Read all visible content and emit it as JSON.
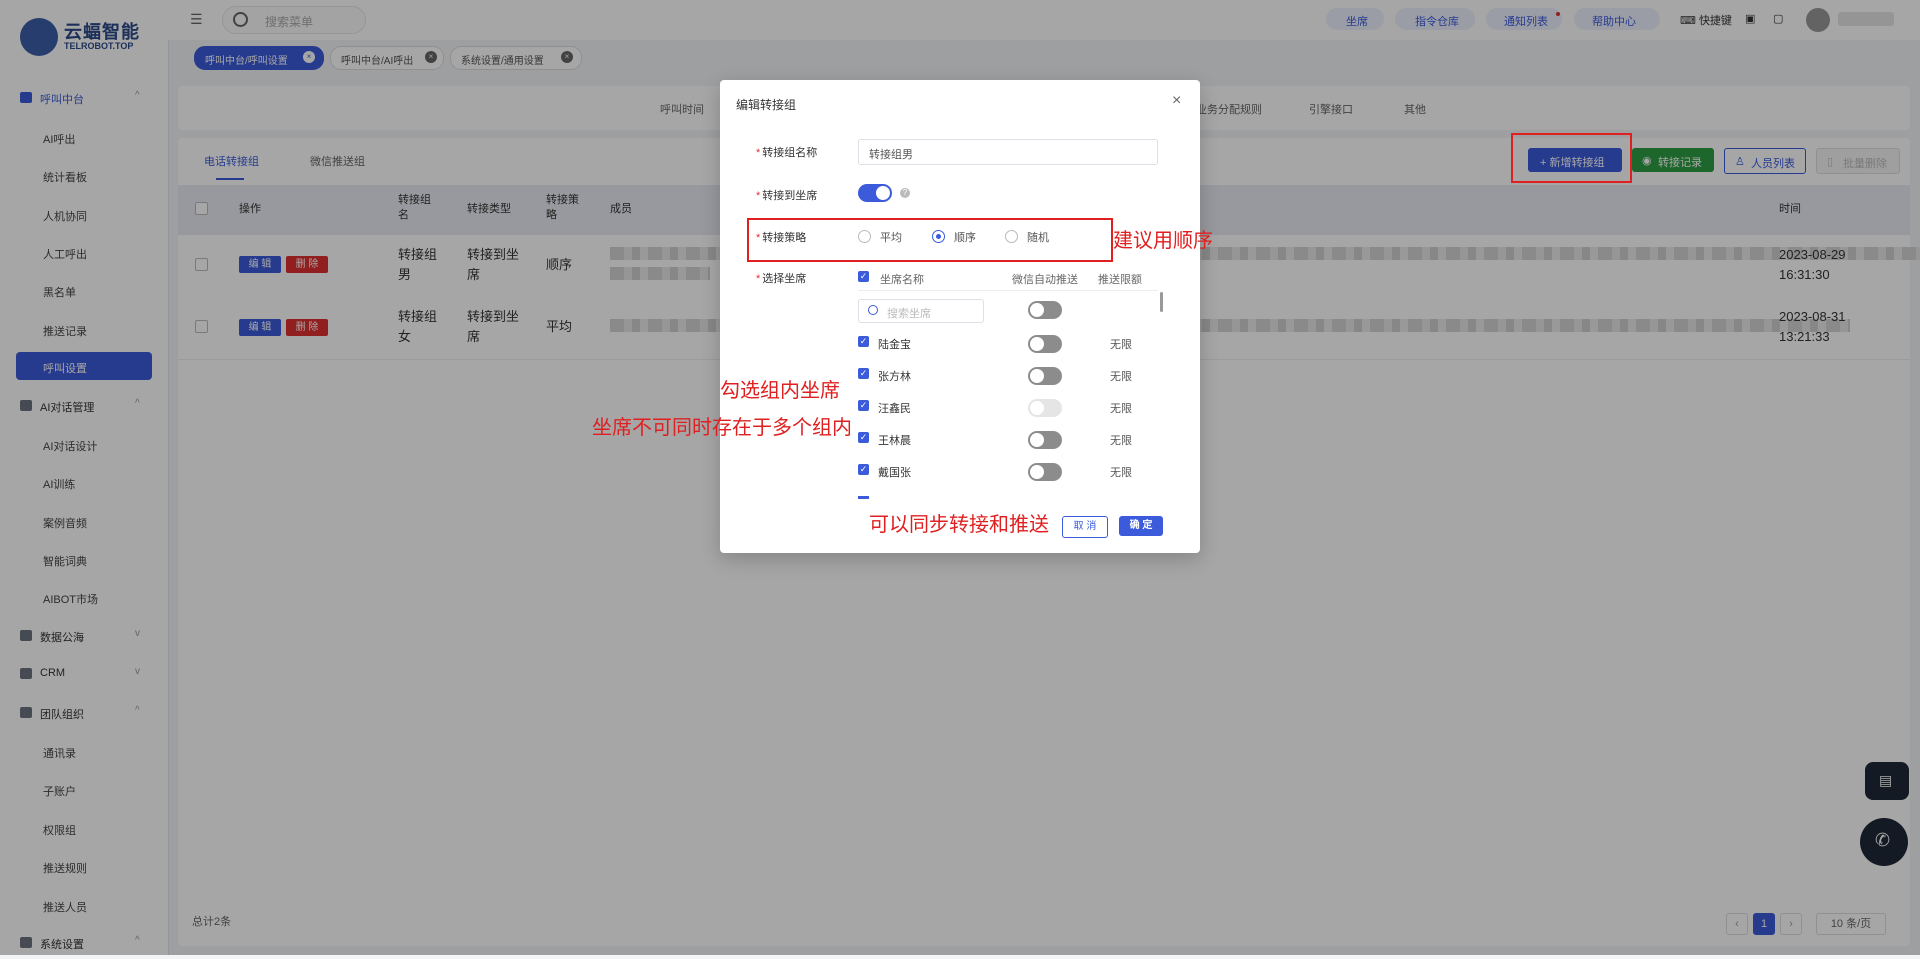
{
  "logo": {
    "cn": "云蝠智能",
    "en": "TELROBOT.TOP",
    "reg": "®"
  },
  "sidebar": {
    "groups": [
      {
        "label": "呼叫中台",
        "chev": "^"
      },
      {
        "label": "AI对话管理",
        "chev": "^"
      },
      {
        "label": "数据公海",
        "chev": "v"
      },
      {
        "label": "CRM",
        "chev": "v"
      },
      {
        "label": "团队组织",
        "chev": "^"
      },
      {
        "label": "系统设置",
        "chev": "^"
      }
    ],
    "items": [
      "AI呼出",
      "统计看板",
      "人机协同",
      "人工呼出",
      "黑名单",
      "推送记录",
      "呼叫设置",
      "AI对话设计",
      "AI训练",
      "案例音频",
      "智能词典",
      "AIBOT市场",
      "通讯录",
      "子账户",
      "权限组",
      "推送规则",
      "推送人员"
    ]
  },
  "topbar": {
    "search_placeholder": "搜索菜单",
    "buttons": [
      "坐席",
      "指令仓库",
      "通知列表",
      "帮助中心"
    ],
    "shortcut": "快捷键"
  },
  "tags": [
    {
      "label": "呼叫中台/呼叫设置"
    },
    {
      "label": "呼叫中台/AI呼出"
    },
    {
      "label": "系统设置/通用设置"
    }
  ],
  "top_tabs": [
    "呼叫时间",
    "业务分配规则",
    "引擎接口",
    "其他"
  ],
  "sub_tabs": [
    "电话转接组",
    "微信推送组"
  ],
  "header_buttons": {
    "add": "+ 新增转接组",
    "record": "转接记录",
    "people": "人员列表",
    "batch_delete": "批量删除"
  },
  "table": {
    "headers": {
      "op": "操作",
      "name": "转接组名",
      "type": "转接类型",
      "strategy": "转接策略",
      "members": "成员",
      "time": "时间"
    },
    "edit_label": "编 辑",
    "delete_label": "删 除",
    "rows": [
      {
        "name": "转接组男",
        "type": "转接到坐席",
        "strategy": "顺序",
        "date": "2023-08-29",
        "time": "16:31:30"
      },
      {
        "name": "转接组女",
        "type": "转接到坐席",
        "strategy": "平均",
        "date": "2023-08-31",
        "time": "13:21:33"
      }
    ]
  },
  "footer": {
    "total": "总计2条",
    "page": "1",
    "page_size": "10 条/页"
  },
  "dialog": {
    "title": "编辑转接组",
    "close": "×",
    "name_label": "转接组名称",
    "name_value": "转接组男",
    "to_seat_label": "转接到坐席",
    "help": "?",
    "strategy_label": "转接策略",
    "strategies": [
      "平均",
      "顺序",
      "随机"
    ],
    "selected_strategy": "顺序",
    "select_seat_label": "选择坐席",
    "col_seat_name": "坐席名称",
    "col_wechat_push": "微信自动推送",
    "col_push_limit": "推送限额",
    "seat_search_placeholder": "搜索坐席",
    "agents": [
      {
        "name": "陆金宝",
        "limit": "无限",
        "switch": "off"
      },
      {
        "name": "张方林",
        "limit": "无限",
        "switch": "off"
      },
      {
        "name": "汪鑫民",
        "limit": "无限",
        "switch": "disabled"
      },
      {
        "name": "王林晨",
        "limit": "无限",
        "switch": "off"
      },
      {
        "name": "戴国张",
        "limit": "无限",
        "switch": "off"
      }
    ],
    "cancel": "取 消",
    "ok": "确 定"
  },
  "annotations": {
    "strategy_tip": "建议用顺序",
    "check_tip": "勾选组内坐席",
    "unique_tip": "坐席不可同时存在于多个组内",
    "sync_tip": "可以同步转接和推送"
  },
  "colors": {
    "primary": "#3b5bdb",
    "danger": "#e03131",
    "success": "#2f9e44",
    "annotation": "#e02020"
  }
}
